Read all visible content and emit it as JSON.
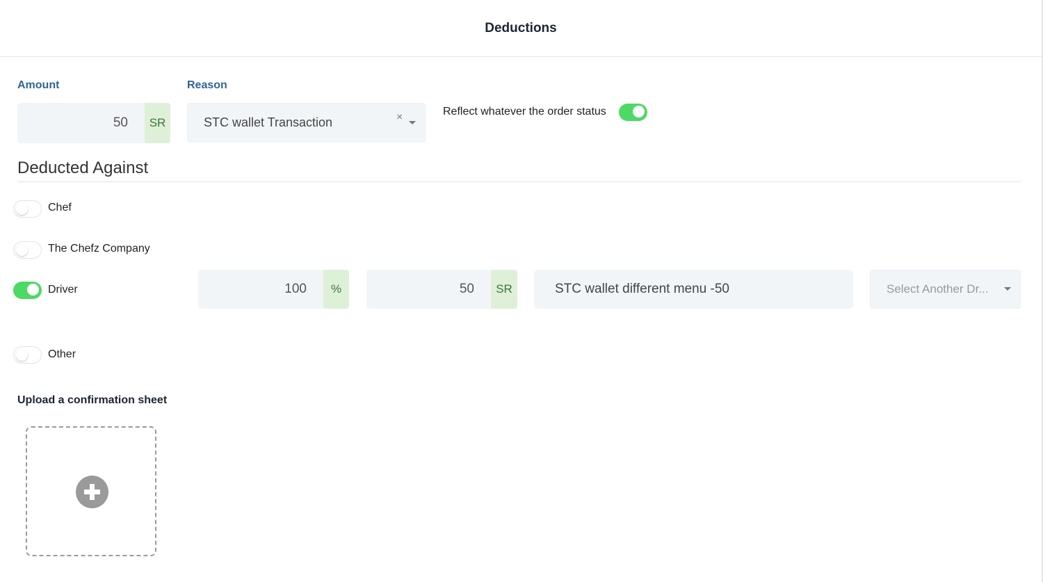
{
  "dialog": {
    "title": "Deductions"
  },
  "amount": {
    "label": "Amount",
    "value": "50",
    "currency": "SR"
  },
  "reason": {
    "label": "Reason",
    "selected": "STC wallet Transaction",
    "clear_symbol": "×"
  },
  "reflect": {
    "label": "Reflect whatever the order status",
    "enabled": true
  },
  "deducted_against": {
    "title": "Deducted Against",
    "parties": [
      {
        "label": "Chef",
        "enabled": false
      },
      {
        "label": "The Chefz Company",
        "enabled": false
      },
      {
        "label": "Driver",
        "enabled": true
      },
      {
        "label": "Other",
        "enabled": false
      }
    ],
    "driver": {
      "percent_value": "100",
      "percent_symbol": "%",
      "amount_value": "50",
      "currency": "SR",
      "note": "STC wallet different menu -50",
      "another_driver_placeholder": "Select Another Dr..."
    }
  },
  "upload": {
    "label": "Upload a confirmation sheet",
    "icon": "plus-circle-icon"
  },
  "colors": {
    "accent": "#2f6594",
    "toggle_on": "#4cd964",
    "addon_bg": "#dff0d8",
    "addon_text": "#3c763d",
    "field_bg": "#f2f5f8"
  }
}
